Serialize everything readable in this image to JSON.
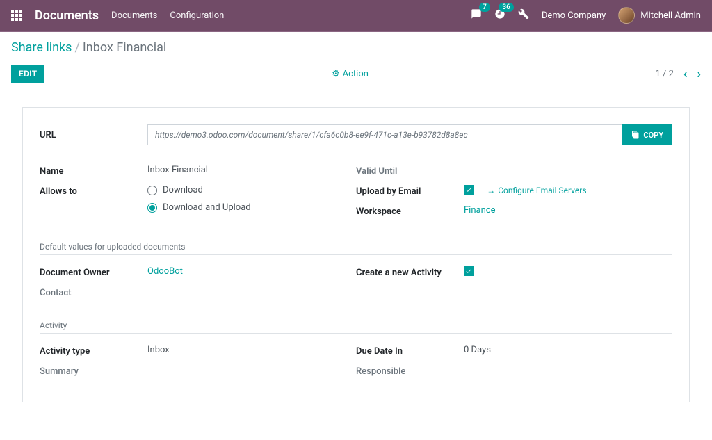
{
  "topnav": {
    "app_title": "Documents",
    "menu_items": [
      "Documents",
      "Configuration"
    ],
    "chat_badge": "7",
    "activity_badge": "36",
    "company": "Demo Company",
    "user_name": "Mitchell Admin"
  },
  "breadcrumbs": {
    "parent": "Share links",
    "current": "Inbox Financial"
  },
  "buttons": {
    "edit": "EDIT",
    "action": "Action",
    "copy": "COPY"
  },
  "pager": {
    "position": "1 / 2"
  },
  "form": {
    "url_label": "URL",
    "url_value": "https://demo3.odoo.com/document/share/1/cfa6c0b8-ee9f-471c-a13e-b93782d8a8ec",
    "name_label": "Name",
    "name_value": "Inbox Financial",
    "allows_label": "Allows to",
    "allow_opts": {
      "download": "Download",
      "download_upload": "Download and Upload"
    },
    "valid_until_label": "Valid Until",
    "upload_email_label": "Upload by Email",
    "configure_email": "Configure Email Servers",
    "workspace_label": "Workspace",
    "workspace_value": "Finance",
    "section_defaults": "Default values for uploaded documents",
    "owner_label": "Document Owner",
    "owner_value": "OdooBot",
    "contact_label": "Contact",
    "create_activity_label": "Create a new Activity",
    "section_activity": "Activity",
    "activity_type_label": "Activity type",
    "activity_type_value": "Inbox",
    "summary_label": "Summary",
    "due_date_label": "Due Date In",
    "due_date_value": "0",
    "due_date_unit": "Days",
    "responsible_label": "Responsible"
  }
}
